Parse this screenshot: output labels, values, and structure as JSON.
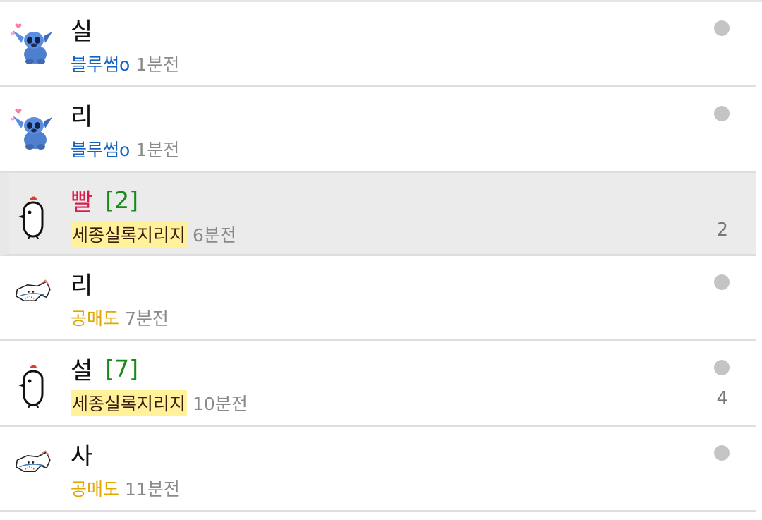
{
  "posts": [
    {
      "title": "실",
      "author": "블루썸o",
      "time": "1분전",
      "comments": "",
      "badge": "",
      "unread_dot": true,
      "avatar_icon": "stitch-avatar"
    },
    {
      "title": "리",
      "author": "블루썸o",
      "time": "1분전",
      "comments": "",
      "badge": "",
      "unread_dot": true,
      "avatar_icon": "stitch-avatar"
    },
    {
      "title": "빨",
      "author": "세종실록지리지",
      "time": "6분전",
      "comments": "[2]",
      "badge": "2",
      "unread_dot": false,
      "avatar_icon": "chick-avatar"
    },
    {
      "title": "리",
      "author": "공매도",
      "time": "7분전",
      "comments": "",
      "badge": "",
      "unread_dot": true,
      "avatar_icon": "fish-avatar"
    },
    {
      "title": "설",
      "author": "세종실록지리지",
      "time": "10분전",
      "comments": "[7]",
      "badge": "4",
      "unread_dot": true,
      "avatar_icon": "chick-avatar"
    },
    {
      "title": "사",
      "author": "공매도",
      "time": "11분전",
      "comments": "",
      "badge": "",
      "unread_dot": true,
      "avatar_icon": "fish-avatar"
    }
  ],
  "colors": {
    "author_blue": "#1565c0",
    "author_gold": "#e0a800",
    "author_highlight_bg": "#fff29a",
    "title_red": "#d81b4c",
    "comment_green": "#178a17",
    "unread_dot": "#c4c4c4",
    "selected_row_bg": "#ebebeb"
  }
}
